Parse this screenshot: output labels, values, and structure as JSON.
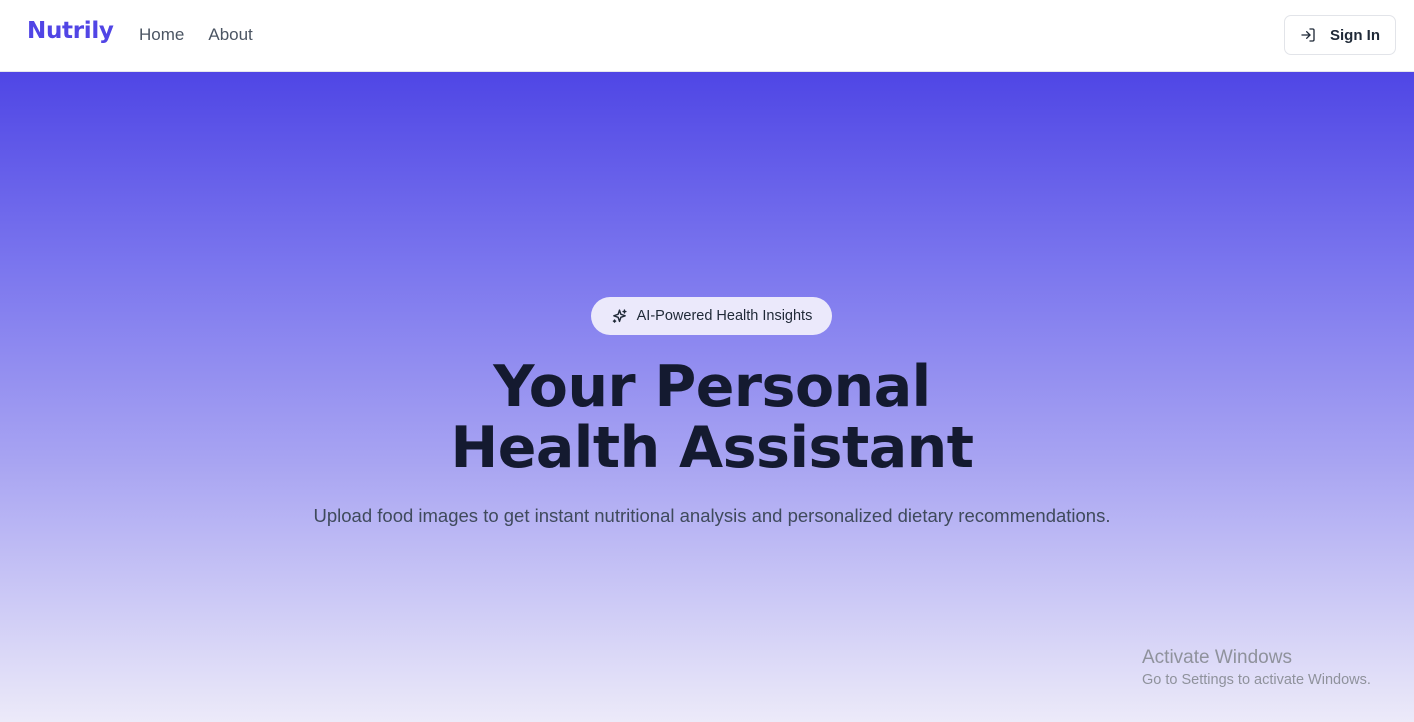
{
  "navbar": {
    "brand": "Nutrily",
    "links": [
      {
        "label": "Home"
      },
      {
        "label": "About"
      }
    ],
    "signin": {
      "label": "Sign In",
      "icon": "sign-in-icon"
    }
  },
  "hero": {
    "badge": {
      "label": "AI-Powered Health Insights",
      "icon": "sparkles-icon"
    },
    "headline": {
      "line1": "Your Personal",
      "line2": "Health Assistant"
    },
    "subtitle": "Upload food images to get instant nutritional analysis and personalized dietary recommendations."
  },
  "watermark": {
    "title": "Activate Windows",
    "subtitle": "Go to Settings to activate Windows."
  },
  "colors": {
    "brand": "#5145e5",
    "gradient_top": "#4f46e5",
    "gradient_bottom": "#eceaf9",
    "headline": "#141a30"
  }
}
